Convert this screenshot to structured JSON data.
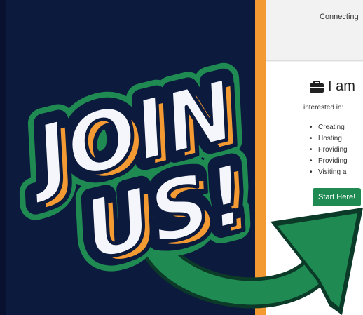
{
  "page": {
    "top_text": "Connecting",
    "heading": "I am",
    "heading_icon": "briefcase-icon",
    "interest_label": "interested in:",
    "interest_items": [
      "Creating",
      "Hosting",
      "Providing",
      "Providing",
      "Visiting a"
    ],
    "start_button": "Start Here!"
  },
  "banner": {
    "line1": "JOIN",
    "line2": "US!"
  },
  "colors": {
    "navy": "#0c1a3d",
    "orange": "#f39a32",
    "green": "#1f8a52",
    "white": "#ffffff"
  }
}
